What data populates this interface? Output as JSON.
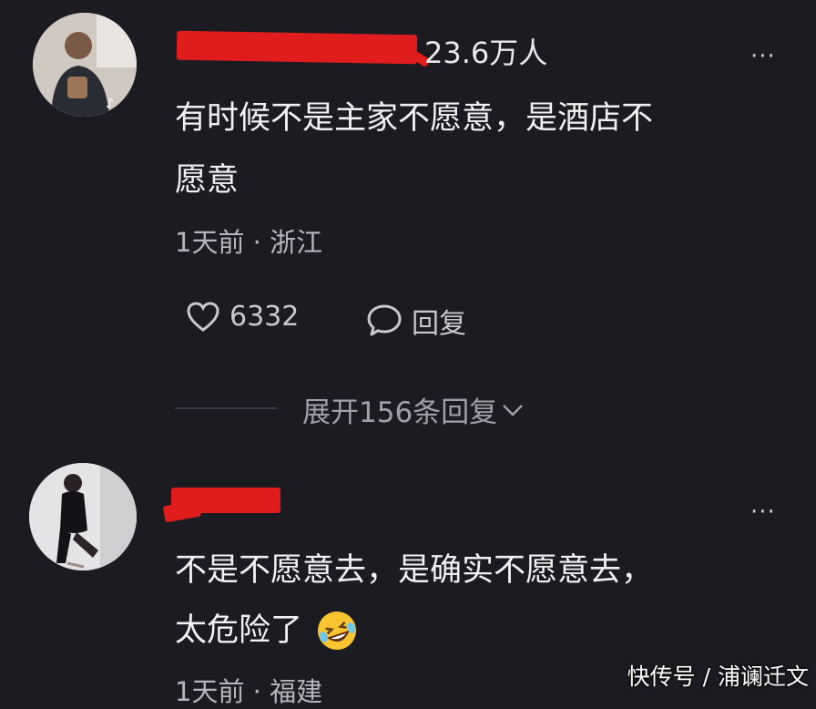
{
  "comments": [
    {
      "follower_count": "23.6万人",
      "text_line1": "有时候不是主家不愿意，是酒店不",
      "text_line2": "愿意",
      "time_location": "1天前 · 浙江",
      "like_count": "6332",
      "reply_label": "回复",
      "expand_label": "展开156条回复"
    },
    {
      "text_line1": "不是不愿意去，是确实不愿意去，",
      "text_line2": "太危险了",
      "emoji": "🤣",
      "time_location": "1天前 · 福建"
    }
  ],
  "more_label": "···",
  "watermark": "快传号 / 浦谰迁文",
  "colors": {
    "background": "#1c1b21",
    "redaction": "#e01c1c"
  }
}
